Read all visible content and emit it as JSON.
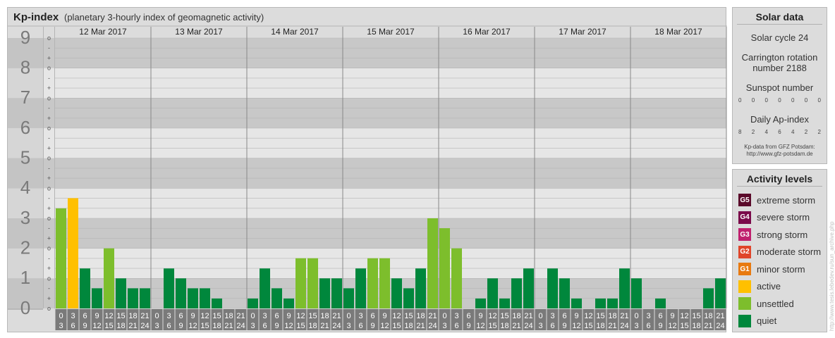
{
  "header": {
    "title": "Kp-index",
    "subtitle": "(planetary 3-hourly index of geomagnetic activity)"
  },
  "chart_data": {
    "type": "bar",
    "title": "Kp-index",
    "subtitle": "(planetary 3-hourly index of geomagnetic activity)",
    "ylim": [
      0,
      9
    ],
    "y_ticks": [
      "0",
      "1",
      "2",
      "3",
      "4",
      "5",
      "6",
      "7",
      "8",
      "9"
    ],
    "minor_labels": [
      "o",
      "+",
      "-",
      "o",
      "+",
      "-",
      "o",
      "+",
      "-",
      "o",
      "+",
      "-",
      "o",
      "+",
      "-",
      "o",
      "+",
      "-",
      "o",
      "+",
      "-",
      "o",
      "+",
      "-",
      "o",
      "+",
      "-",
      "o"
    ],
    "days": [
      "12 Mar 2017",
      "13 Mar 2017",
      "14 Mar 2017",
      "15 Mar 2017",
      "16 Mar 2017",
      "17 Mar 2017",
      "18 Mar 2017"
    ],
    "interval_labels": [
      [
        "0",
        "3"
      ],
      [
        "3",
        "6"
      ],
      [
        "6",
        "9"
      ],
      [
        "9",
        "12"
      ],
      [
        "12",
        "15"
      ],
      [
        "15",
        "18"
      ],
      [
        "18",
        "21"
      ],
      [
        "21",
        "24"
      ]
    ],
    "values": [
      [
        3.33,
        3.67,
        1.33,
        0.67,
        2.0,
        1.0,
        0.67,
        0.67
      ],
      [
        0.0,
        1.33,
        1.0,
        0.67,
        0.67,
        0.33,
        0.0,
        0.0
      ],
      [
        0.33,
        1.33,
        0.67,
        0.33,
        1.67,
        1.67,
        1.0,
        1.0
      ],
      [
        0.67,
        1.33,
        1.67,
        1.67,
        1.0,
        0.67,
        1.33,
        3.0
      ],
      [
        2.67,
        2.0,
        0.0,
        0.33,
        1.0,
        0.33,
        1.0,
        1.33
      ],
      [
        0.0,
        1.33,
        1.0,
        0.33,
        0.0,
        0.33,
        0.33,
        1.33
      ],
      [
        1.0,
        0.0,
        0.33,
        0.0,
        0.0,
        0.0,
        0.67,
        1.0
      ]
    ],
    "bar_colors": [
      [
        "#7dbe2c",
        "#ffc000",
        "#00873c",
        "#00873c",
        "#7dbe2c",
        "#00873c",
        "#00873c",
        "#00873c"
      ],
      [
        "#00873c",
        "#00873c",
        "#00873c",
        "#00873c",
        "#00873c",
        "#00873c",
        "#00873c",
        "#00873c"
      ],
      [
        "#00873c",
        "#00873c",
        "#00873c",
        "#00873c",
        "#7dbe2c",
        "#7dbe2c",
        "#00873c",
        "#00873c"
      ],
      [
        "#00873c",
        "#00873c",
        "#7dbe2c",
        "#7dbe2c",
        "#00873c",
        "#00873c",
        "#00873c",
        "#7dbe2c"
      ],
      [
        "#7dbe2c",
        "#7dbe2c",
        "#00873c",
        "#00873c",
        "#00873c",
        "#00873c",
        "#00873c",
        "#00873c"
      ],
      [
        "#00873c",
        "#00873c",
        "#00873c",
        "#00873c",
        "#00873c",
        "#00873c",
        "#00873c",
        "#00873c"
      ],
      [
        "#00873c",
        "#00873c",
        "#00873c",
        "#00873c",
        "#00873c",
        "#00873c",
        "#00873c",
        "#00873c"
      ]
    ],
    "colors": {
      "band_dark": "#c8c8c8",
      "band_light": "#e6e6e6",
      "gridline": "#b4b4b4",
      "axis_label": "#7a7a7a",
      "axis_bg": "#b8b8b8"
    }
  },
  "solar": {
    "title": "Solar data",
    "cycle": "Solar cycle 24",
    "carrington_line1": "Carrington rotation",
    "carrington_line2": "number 2188",
    "sunspot_label": "Sunspot number",
    "sunspot_values": [
      "0",
      "0",
      "0",
      "0",
      "0",
      "0",
      "0"
    ],
    "ap_label": "Daily Ap-index",
    "ap_values": [
      "8",
      "2",
      "4",
      "6",
      "4",
      "2",
      "2"
    ],
    "credit_line1": "Kp-data from GFZ Potsdam:",
    "credit_line2": "http://www.gfz-potsdam.de"
  },
  "activity": {
    "title": "Activity levels",
    "levels": [
      {
        "code": "G5",
        "label": "extreme storm",
        "color": "#5a0a2a"
      },
      {
        "code": "G4",
        "label": "severe storm",
        "color": "#7a0a4a"
      },
      {
        "code": "G3",
        "label": "strong storm",
        "color": "#c0206e"
      },
      {
        "code": "G2",
        "label": "moderate storm",
        "color": "#e0452a"
      },
      {
        "code": "G1",
        "label": "minor storm",
        "color": "#e87a10"
      },
      {
        "code": "",
        "label": "active",
        "color": "#ffc000"
      },
      {
        "code": "",
        "label": "unsettled",
        "color": "#7dbe2c"
      },
      {
        "code": "",
        "label": "quiet",
        "color": "#00873c"
      }
    ]
  },
  "watermark": "http://www.tesis.lebedev.ru/sun_archive.php"
}
